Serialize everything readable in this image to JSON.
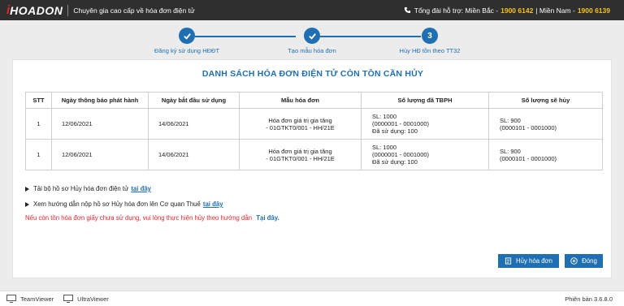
{
  "header": {
    "logo_mark": "i",
    "logo_text": "HOADON",
    "tagline": "Chuyên gia cao cấp về hóa đơn điện tử",
    "support_label": "Tổng đài hỗ trợ: Miền Bắc -",
    "support_phone_north": "1900 6142",
    "support_sep": "| Miền Nam -",
    "support_phone_south": "1900 6139"
  },
  "steps": [
    {
      "label": "Đăng ký sử dụng HĐĐT",
      "state": "done",
      "number": "1"
    },
    {
      "label": "Tạo mẫu hóa đơn",
      "state": "done",
      "number": "2"
    },
    {
      "label": "Hủy HĐ tồn theo TT32",
      "state": "current",
      "number": "3"
    }
  ],
  "main": {
    "title": "DANH SÁCH HÓA ĐƠN ĐIỆN TỬ CÒN TỒN CẦN HỦY",
    "columns": [
      "STT",
      "Ngày thông báo phát hành",
      "Ngày bắt đầu sử dụng",
      "Mẫu hóa đơn",
      "Số lượng đã TBPH",
      "Số lượng sẽ hủy"
    ],
    "rows": [
      {
        "stt": "1",
        "notice_date": "12/06/2021",
        "start_date": "14/06/2021",
        "template_line1": "Hóa đơn giá trị gia tăng",
        "template_line2": "- 01GTKT0/001 - HH/21E",
        "tbph_line1": "SL: 1000",
        "tbph_line2": "(0000001 - 0001000)",
        "tbph_line3": "Đã sử dụng: 100",
        "cancel_line1": "SL: 900",
        "cancel_line2": "(0000101 - 0001000)"
      },
      {
        "stt": "1",
        "notice_date": "12/06/2021",
        "start_date": "14/06/2021",
        "template_line1": "Hóa đơn giá trị gia tăng",
        "template_line2": "- 01GTKT0/001 - HH/21E",
        "tbph_line1": "SL: 1000",
        "tbph_line2": "(0000001 - 0001000)",
        "tbph_line3": "Đã sử dụng: 100",
        "cancel_line1": "SL: 900",
        "cancel_line2": "(0000101 - 0001000)"
      }
    ],
    "link1_text": "Tải bộ hồ sơ Hủy hóa đơn điện tử",
    "link1_anchor": "tại đây",
    "link2_text": "Xem hướng dẫn nộp hồ sơ Hủy hóa đơn lên Cơ quan Thuế",
    "link2_anchor": "tại đây",
    "warning_text": "Nếu còn tồn hóa đơn giấy chưa sử dụng, vui lòng thực hiện hủy theo hướng dẫn",
    "warning_anchor": "Tại đây.",
    "cancel_button": "Hủy hóa đơn",
    "close_button": "Đóng"
  },
  "footer": {
    "teamviewer": "TeamViewer",
    "ultraviewer": "UltraViewer",
    "version": "Phiên bản 3.6.8.0"
  },
  "colors": {
    "primary": "#1f6fb2",
    "topbar": "#2f2f2f",
    "phone": "#f7c31a",
    "warning": "#e8262c"
  }
}
